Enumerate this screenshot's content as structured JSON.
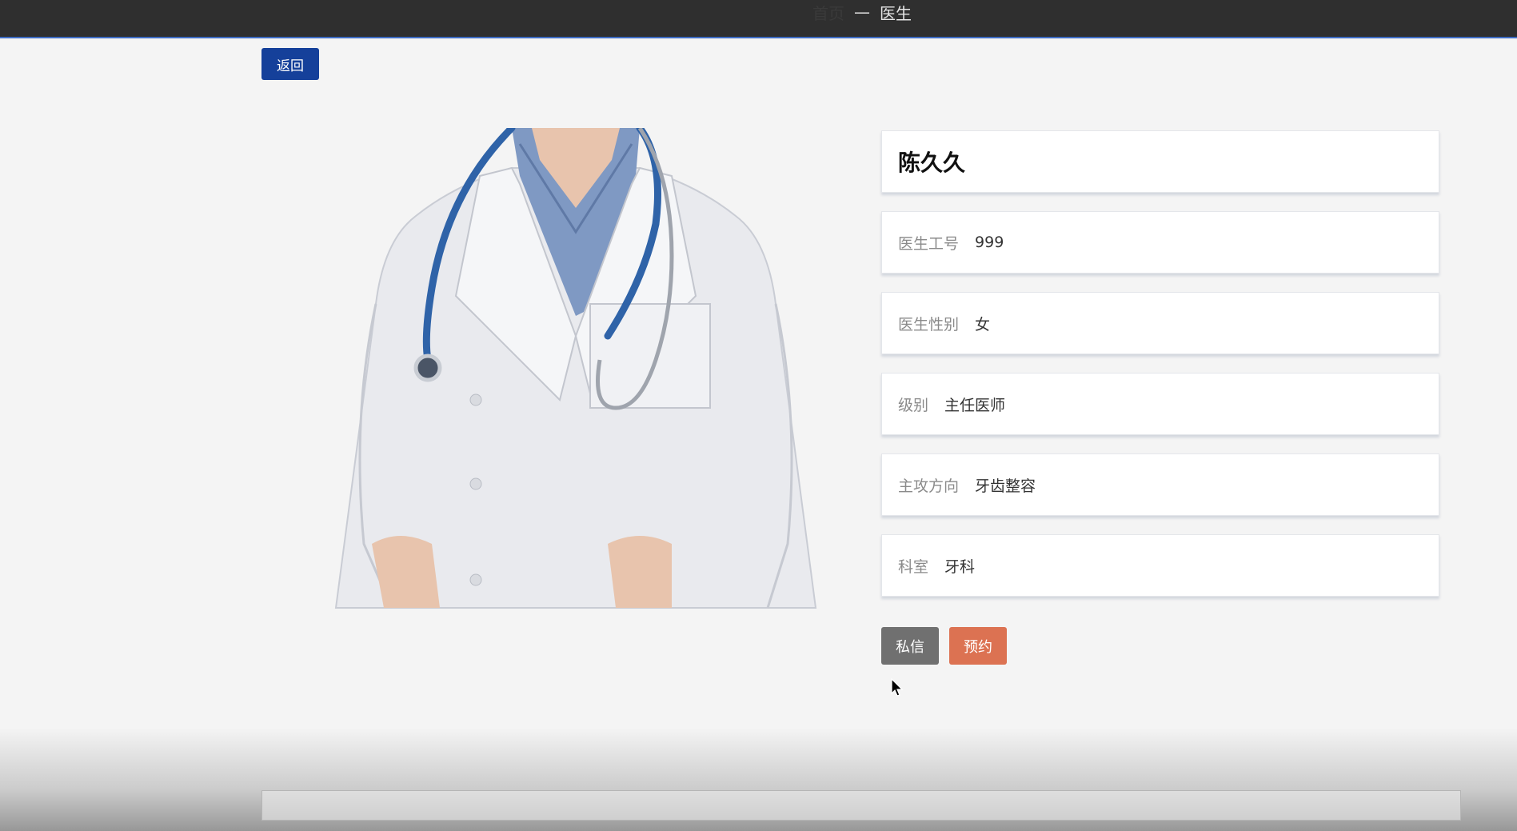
{
  "breadcrumb": {
    "home": "首页",
    "separator": "—",
    "current": "医生"
  },
  "back_button": {
    "label": "返回"
  },
  "doctor": {
    "name": "陈久久",
    "fields": [
      {
        "label": "医生工号",
        "value": "999"
      },
      {
        "label": "医生性别",
        "value": "女"
      },
      {
        "label": "级别",
        "value": "主任医师"
      },
      {
        "label": "主攻方向",
        "value": "牙齿整容"
      },
      {
        "label": "科室",
        "value": "牙科"
      }
    ]
  },
  "actions": {
    "message_label": "私信",
    "book_label": "预约"
  },
  "colors": {
    "topbar": "#2f2f2f",
    "back_button": "#15409a",
    "message_button": "#707070",
    "book_button": "#dc7252"
  }
}
